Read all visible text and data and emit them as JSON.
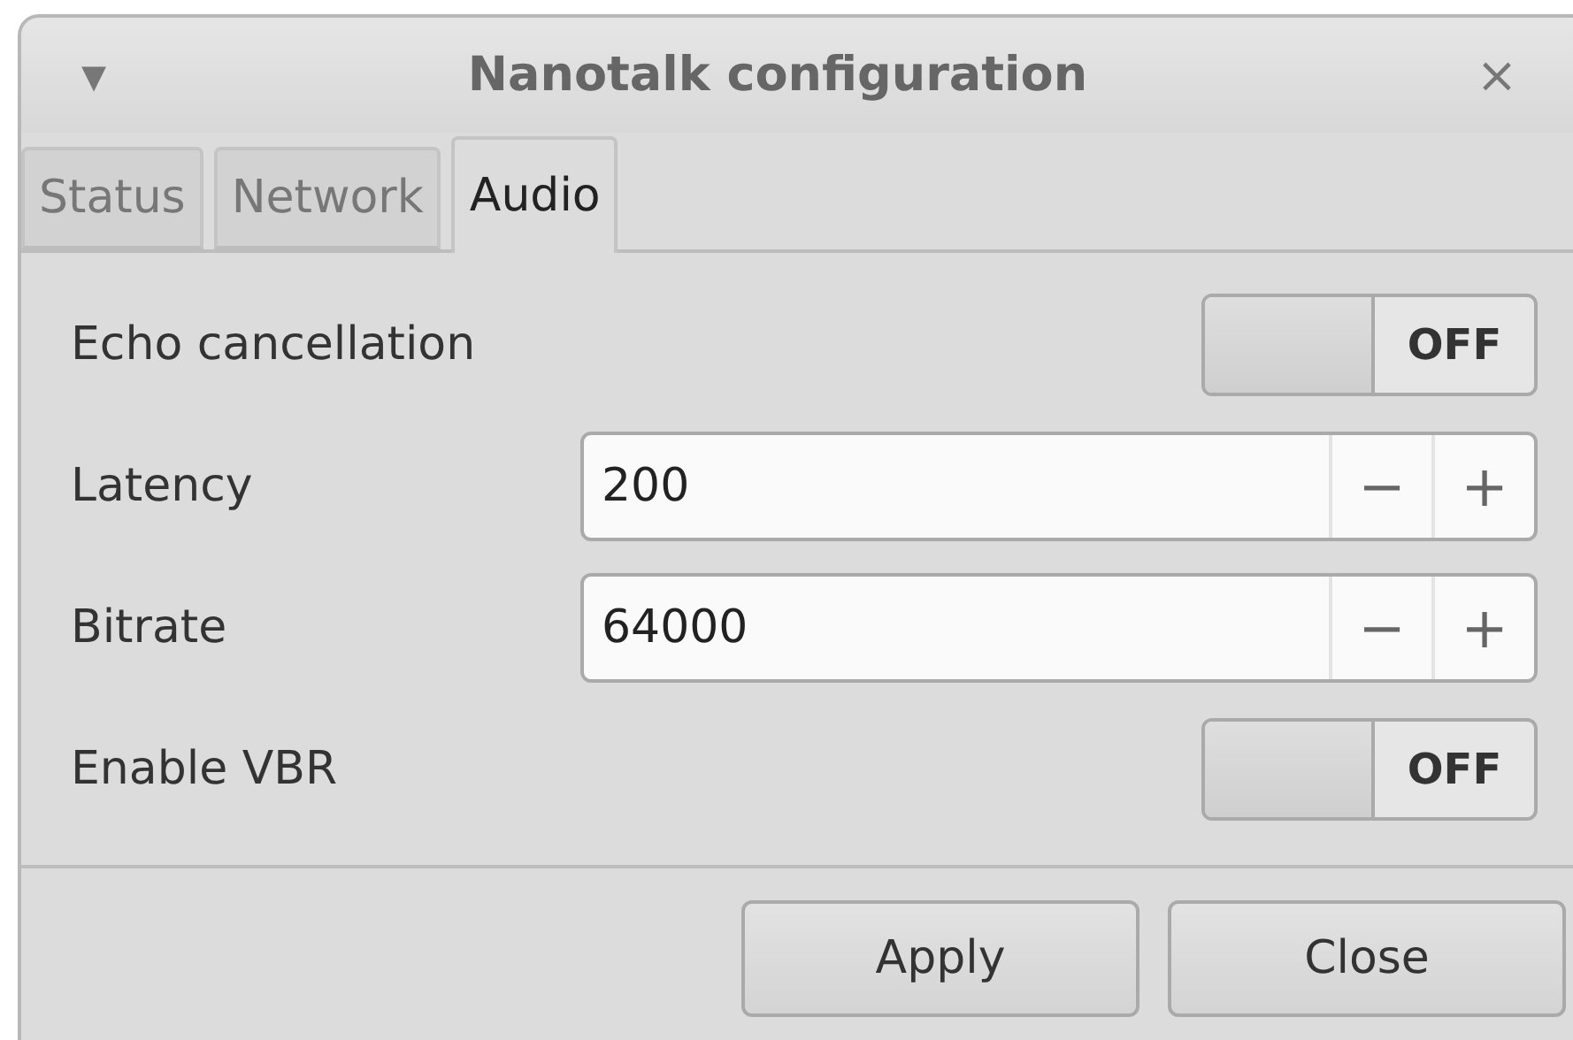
{
  "window": {
    "title": "Nanotalk configuration",
    "menu_glyph": "▾",
    "close_glyph": "×"
  },
  "tabs": [
    {
      "label": "Status",
      "selected": false
    },
    {
      "label": "Network",
      "selected": false
    },
    {
      "label": "Audio",
      "selected": true
    }
  ],
  "rows": [
    {
      "kind": "switch",
      "label": "Echo cancellation",
      "on": false,
      "state_text": "OFF"
    },
    {
      "kind": "spin",
      "label": "Latency",
      "value": "200",
      "minus": "−",
      "plus": "+"
    },
    {
      "kind": "spin",
      "label": "Bitrate",
      "value": "64000",
      "minus": "−",
      "plus": "+"
    },
    {
      "kind": "switch",
      "label": "Enable VBR",
      "on": false,
      "state_text": "OFF"
    }
  ],
  "buttons": [
    "Apply",
    "Close"
  ]
}
